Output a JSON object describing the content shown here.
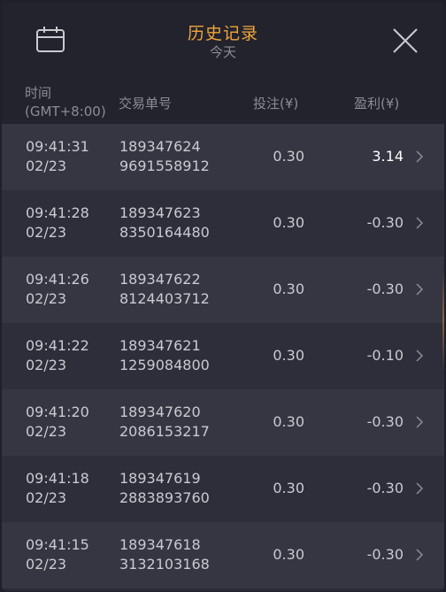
{
  "header": {
    "title": "历史记录",
    "subtitle": "今天",
    "calendar_icon": "calendar-icon",
    "close_icon": "close-icon"
  },
  "columns": {
    "time_line1": "时间",
    "time_line2": "(GMT+8:00)",
    "trade_id": "交易单号",
    "bet": "投注(¥)",
    "profit": "盈利(¥)"
  },
  "rows": [
    {
      "time": "09:41:31",
      "date": "02/23",
      "id1": "189347624",
      "id2": "9691558912",
      "bet": "0.30",
      "profit": "3.14"
    },
    {
      "time": "09:41:28",
      "date": "02/23",
      "id1": "189347623",
      "id2": "8350164480",
      "bet": "0.30",
      "profit": "-0.30"
    },
    {
      "time": "09:41:26",
      "date": "02/23",
      "id1": "189347622",
      "id2": "8124403712",
      "bet": "0.30",
      "profit": "-0.30"
    },
    {
      "time": "09:41:22",
      "date": "02/23",
      "id1": "189347621",
      "id2": "1259084800",
      "bet": "0.30",
      "profit": "-0.10"
    },
    {
      "time": "09:41:20",
      "date": "02/23",
      "id1": "189347620",
      "id2": "2086153217",
      "bet": "0.30",
      "profit": "-0.30"
    },
    {
      "time": "09:41:18",
      "date": "02/23",
      "id1": "189347619",
      "id2": "2883893760",
      "bet": "0.30",
      "profit": "-0.30"
    },
    {
      "time": "09:41:15",
      "date": "02/23",
      "id1": "189347618",
      "id2": "3132103168",
      "bet": "0.30",
      "profit": "-0.30"
    }
  ],
  "colors": {
    "accent": "#f0a53c",
    "background": "#2a2b36",
    "header": "#22232d",
    "text": "#c9cad2",
    "muted": "#8b8c96",
    "win": "#ffffff"
  }
}
